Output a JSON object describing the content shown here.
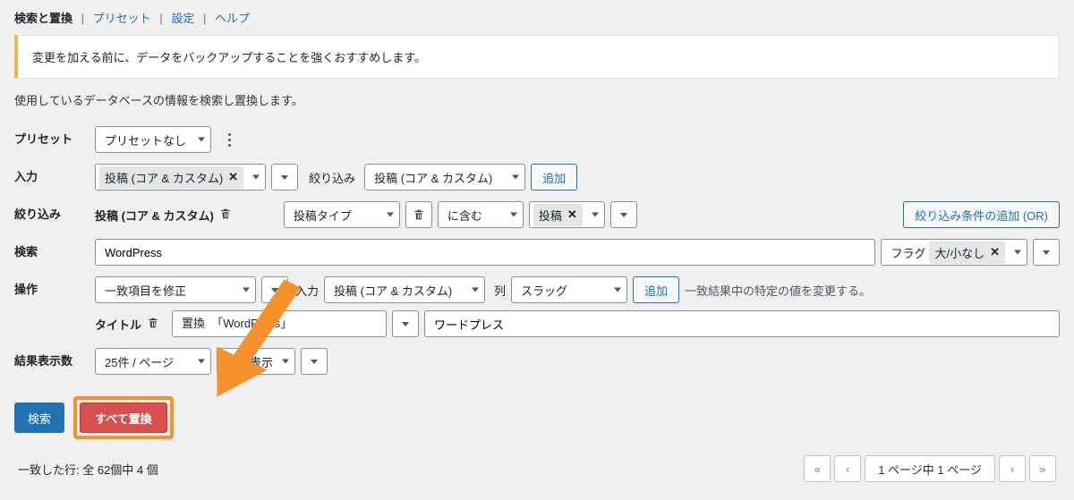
{
  "tabs": {
    "search_replace": "検索と置換",
    "preset": "プリセット",
    "settings": "設定",
    "help": "ヘルプ"
  },
  "notice": "変更を加える前に、データをバックアップすることを強くおすすめします。",
  "description": "使用しているデータベースの情報を検索し置換します。",
  "labels": {
    "preset": "プリセット",
    "input": "入力",
    "filter": "絞り込み",
    "search": "検索",
    "operation": "操作",
    "results_per_page": "結果表示数",
    "refine_by": "絞り込み",
    "column": "列",
    "flag": "フラグ",
    "title": "タイトル"
  },
  "preset_select": "プリセットなし",
  "input_chip": "投稿 (コア & カスタム)",
  "refine_select": "投稿 (コア & カスタム)",
  "add_button": "追加",
  "filter_group_label": "投稿 (コア & カスタム)",
  "filter_type_select": "投稿タイプ",
  "contains_select": "に含む",
  "posts_chip": "投稿",
  "add_filter_or": "絞り込み条件の追加 (OR)",
  "search_value": "WordPress",
  "flag_chip": "大/小なし",
  "operation_select": "一致項目を修正",
  "op_input_label": "入力",
  "op_input_select": "投稿 (コア & カスタム)",
  "op_column_label": "列",
  "op_column_select": "スラッグ",
  "op_helper": "一致結果中の特定の値を変更する。",
  "replace_label_prefix": "置換",
  "replace_source": "「WordPress」",
  "replace_value": "ワードプレス",
  "per_page_select": "25件 / ページ",
  "show_columns": "列を表示",
  "search_button": "検索",
  "replace_all_button": "すべて置換",
  "matched_rows": "一致した行: 全 62個中 4 個",
  "page_indicator": "1 ページ中 1 ページ",
  "pager": {
    "first": "«",
    "prev": "‹",
    "next": "›",
    "last": "»"
  }
}
